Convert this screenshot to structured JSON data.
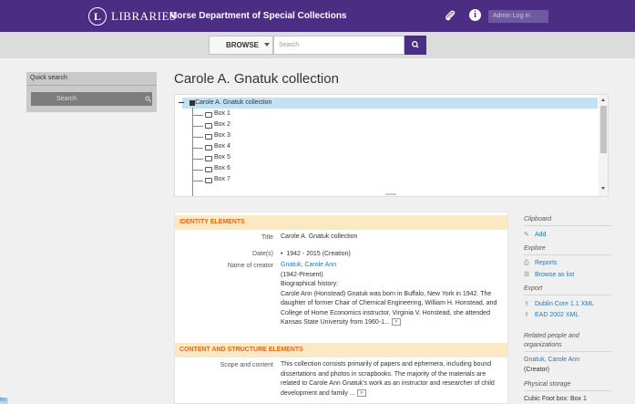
{
  "header": {
    "logo_letter": "L",
    "logo_text": "LIBRARIES",
    "site_title": "Morse Department of Special Collections",
    "login_label": "Admin Log in",
    "brand_color": "#4b2d84"
  },
  "search": {
    "browse_label": "BROWSE",
    "placeholder": "Search"
  },
  "sidebar": {
    "quick_search_label": "Quick search",
    "search_placeholder": "Search"
  },
  "page": {
    "title": "Carole A. Gnatuk collection"
  },
  "tree": {
    "root": "Carole A. Gnatuk collection",
    "items": [
      "Box 1",
      "Box 2",
      "Box 3",
      "Box 4",
      "Box 5",
      "Box 6",
      "Box 7"
    ]
  },
  "identity": {
    "heading": "IDENTITY ELEMENTS",
    "title_label": "Title",
    "title_value": "Carole A. Gnatuk collection",
    "dates_label": "Date(s)",
    "dates_value": "1942 - 2015 (Creation)",
    "creator_label": "Name of creator",
    "creator_name": "Gnatuk, Carole Ann",
    "creator_dates": "(1942-Present)",
    "bio_label": "Biographical history:",
    "bio_text": "Carole Ann (Honstead) Gnatuk was born in Buffalo, New York in 1942. The daughter of former Chair of Chemical Engineering, William H. Honstead, and College of Home Economics instructor, Virginia V. Honstead, she attended Kansas State University from 1960-1...",
    "more": "»"
  },
  "content_structure": {
    "heading": "CONTENT AND STRUCTURE ELEMENTS",
    "scope_label": "Scope and content",
    "scope_text": "This collection consists primarily of papers and ephemera, including bound dissertations and photos in scrapbooks. The majority of the materials are related to Carole Ann Gnatuk's work as an instructor and researcher of child development and family ...",
    "more": "»"
  },
  "context_menu": {
    "clipboard": "Clipboard",
    "add": "Add",
    "explore": "Explore",
    "reports": "Reports",
    "browse_list": "Browse as list",
    "export": "Export",
    "dublin_core": "Dublin Core 1.1 XML",
    "ead": "EAD 2002 XML",
    "related_heading": "Related people and organizations",
    "related_name": "Gnatuk, Carole Ann",
    "related_role": "(Creator)",
    "physical_storage": "Physical storage",
    "storage_text": "Cubic Foot box: Box 1"
  },
  "corner_text": "hn"
}
